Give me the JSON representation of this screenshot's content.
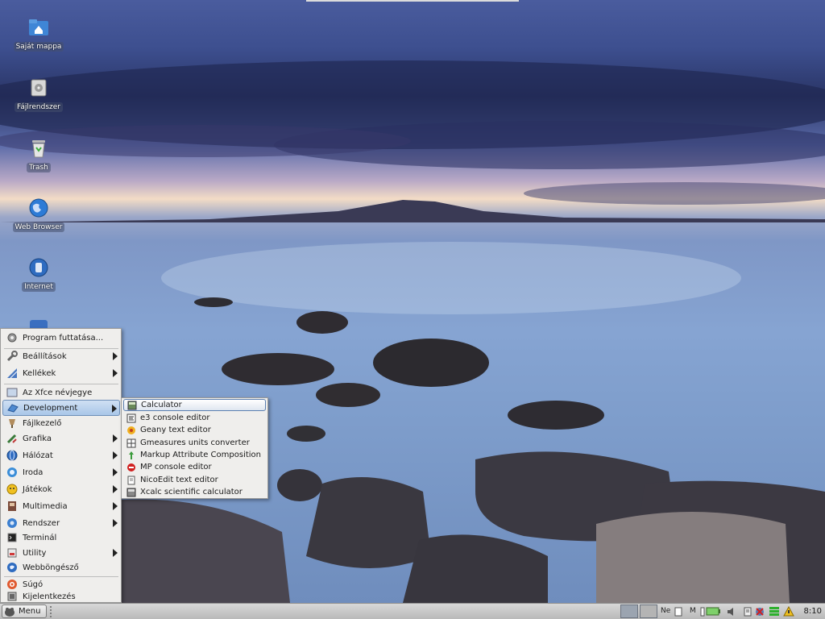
{
  "desktop": {
    "icons": [
      {
        "label": "Saját mappa",
        "icon": "home-folder-icon"
      },
      {
        "label": "Fájlrendszer",
        "icon": "drive-icon"
      },
      {
        "label": "Trash",
        "icon": "trash-icon"
      },
      {
        "label": "Web Browser",
        "icon": "globe-icon"
      },
      {
        "label": "Internet",
        "icon": "internet-icon"
      }
    ]
  },
  "main_menu": {
    "items": [
      {
        "label": "Program futtatása...",
        "icon": "run-gear-icon"
      },
      {
        "label": "Beállítások",
        "icon": "wrench-icon",
        "submenu": true
      },
      {
        "label": "Kellékek",
        "icon": "accessories-icon",
        "submenu": true
      },
      {
        "label": "Az Xfce névjegye",
        "icon": "info-icon"
      },
      {
        "label": "Development",
        "icon": "development-icon",
        "submenu": true,
        "active": true
      },
      {
        "label": "Fájlkezelő",
        "icon": "file-manager-icon"
      },
      {
        "label": "Grafika",
        "icon": "graphics-icon",
        "submenu": true
      },
      {
        "label": "Hálózat",
        "icon": "network-icon",
        "submenu": true
      },
      {
        "label": "Iroda",
        "icon": "office-icon",
        "submenu": true
      },
      {
        "label": "Játékok",
        "icon": "games-icon",
        "submenu": true
      },
      {
        "label": "Multimedia",
        "icon": "multimedia-icon",
        "submenu": true
      },
      {
        "label": "Rendszer",
        "icon": "system-icon",
        "submenu": true
      },
      {
        "label": "Terminál",
        "icon": "terminal-icon"
      },
      {
        "label": "Utility",
        "icon": "utility-icon",
        "submenu": true
      },
      {
        "label": "Webböngésző",
        "icon": "web-browser-icon"
      },
      {
        "label": "Súgó",
        "icon": "help-icon"
      },
      {
        "label": "Kijelentkezés",
        "icon": "logout-icon"
      }
    ]
  },
  "sub_menu": {
    "items": [
      {
        "label": "Calculator",
        "icon": "calculator-icon",
        "active": true
      },
      {
        "label": "e3 console editor",
        "icon": "console-editor-icon"
      },
      {
        "label": "Geany text editor",
        "icon": "geany-icon"
      },
      {
        "label": "Gmeasures units converter",
        "icon": "units-converter-icon"
      },
      {
        "label": "Markup Attribute Composition",
        "icon": "markup-icon"
      },
      {
        "label": "MP console editor",
        "icon": "mp-editor-icon"
      },
      {
        "label": "NicoEdit text editor",
        "icon": "text-editor-icon"
      },
      {
        "label": "Xcalc scientific calculator",
        "icon": "xcalc-icon"
      }
    ]
  },
  "taskbar": {
    "menu_label": "Menu",
    "tray_text_1": "Ne",
    "tray_text_2": "M",
    "clock": "8:10"
  },
  "colors": {
    "menu_bg": "#efeeec",
    "highlight": "#a9c6e8",
    "taskbar": "#c8c8c8"
  }
}
